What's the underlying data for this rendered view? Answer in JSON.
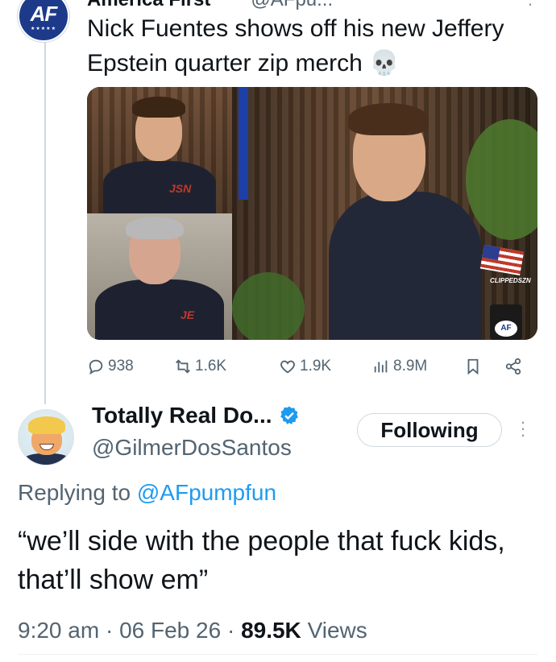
{
  "original_tweet": {
    "avatar_text": "AF",
    "author_name": "America First",
    "author_handle": "@AFpu...",
    "text": "Nick Fuentes shows off his new Jeffery Epstein quarter zip merch 💀",
    "media": {
      "monogram_1": "JSN",
      "monogram_2": "JE",
      "watermark": "CLIPPEDSZN",
      "mug_logo": "AF"
    },
    "actions": {
      "replies": "938",
      "reposts": "1.6K",
      "likes": "1.9K",
      "views": "8.9M"
    }
  },
  "reply_tweet": {
    "author_name": "Totally Real Do...",
    "author_handle": "@GilmerDosSantos",
    "follow_button": "Following",
    "replying_prefix": "Replying to",
    "replying_to": "@AFpumpfun",
    "text": "“we’ll side with the people that fuck kids, that’ll show em”",
    "time": "9:20 am",
    "date": "06 Feb 26",
    "views_count": "89.5K",
    "views_label": "Views",
    "separator": "·"
  },
  "colors": {
    "accent_blue": "#1d9bf0",
    "secondary_text": "#536471",
    "primary_text": "#0f1419",
    "border": "#cfd9de"
  }
}
